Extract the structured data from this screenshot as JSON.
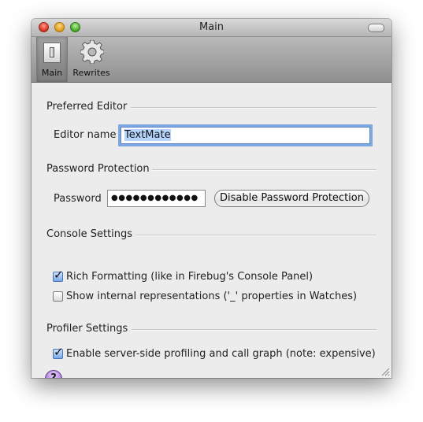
{
  "window": {
    "title": "Main"
  },
  "toolbar": {
    "items": [
      {
        "label": "Main",
        "icon": "switch-icon",
        "selected": true
      },
      {
        "label": "Rewrites",
        "icon": "gear-icon",
        "selected": false
      }
    ]
  },
  "sections": {
    "editor": {
      "title": "Preferred Editor",
      "field_label": "Editor name",
      "field_value": "TextMate"
    },
    "password": {
      "title": "Password Protection",
      "field_label": "Password",
      "field_value": "●●●●●●●●●●●●",
      "button_label": "Disable Password Protection"
    },
    "console": {
      "title": "Console Settings",
      "options": [
        {
          "label": "Rich Formatting (like in Firebug's Console Panel)",
          "checked": true
        },
        {
          "label": "Show internal representations ('_' properties in Watches)",
          "checked": false
        }
      ]
    },
    "profiler": {
      "title": "Profiler Settings",
      "options": [
        {
          "label": "Enable server-side profiling and call graph (note: expensive)",
          "checked": true
        }
      ]
    }
  },
  "help": {
    "label": "?"
  },
  "colors": {
    "accent": "#7fa7e0",
    "selection": "#b5d5ff",
    "help": "#9d6dd8"
  }
}
